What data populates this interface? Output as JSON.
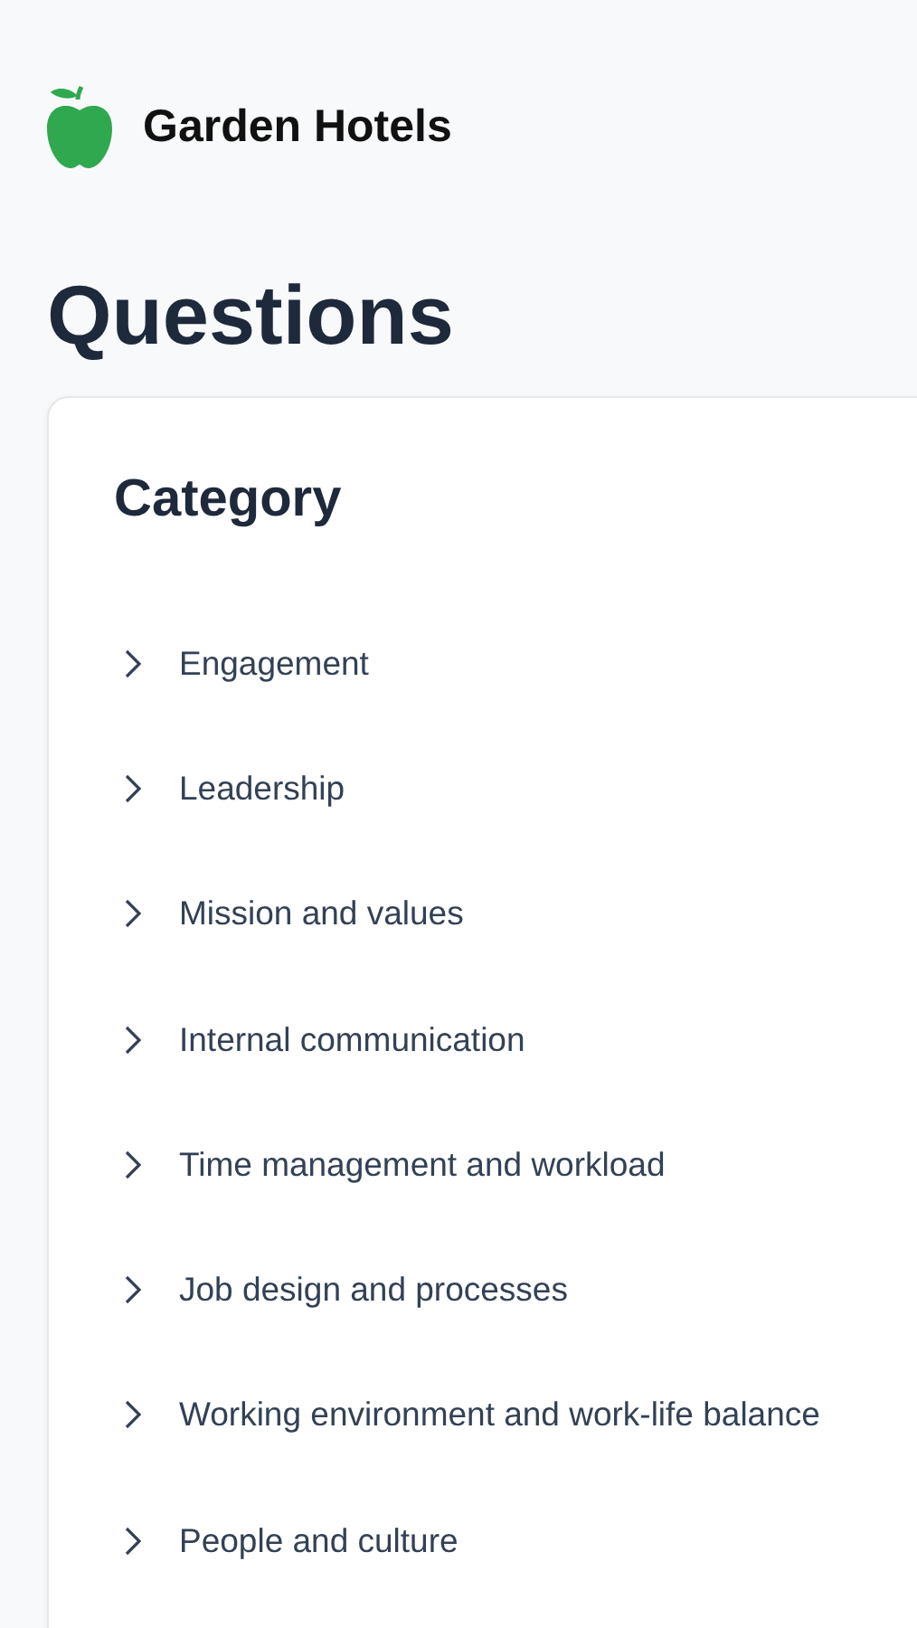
{
  "brand": {
    "name": "Garden Hotels"
  },
  "page": {
    "title": "Questions"
  },
  "category_panel": {
    "heading": "Category",
    "items": [
      {
        "label": "Engagement",
        "expanded": false
      },
      {
        "label": "Leadership",
        "expanded": false
      },
      {
        "label": "Mission and values",
        "expanded": false
      },
      {
        "label": "Internal communication",
        "expanded": false
      },
      {
        "label": "Time management and workload",
        "expanded": false
      },
      {
        "label": "Job design and processes",
        "expanded": false
      },
      {
        "label": "Working environment and work-life balance",
        "expanded": false
      },
      {
        "label": "People and culture",
        "expanded": false
      }
    ]
  }
}
